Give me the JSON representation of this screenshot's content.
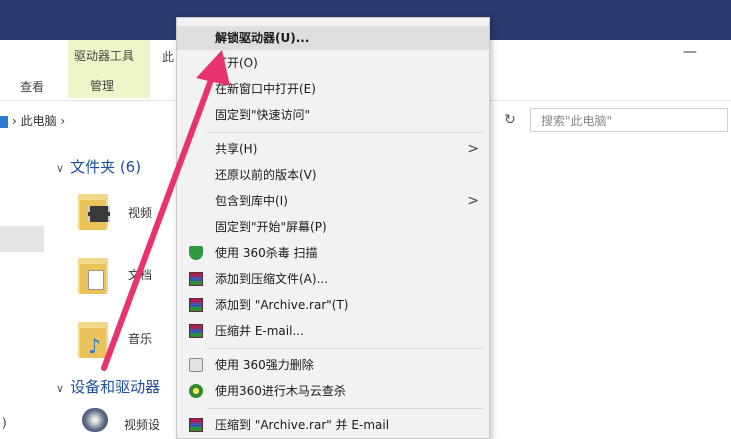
{
  "ribbon": {
    "context_tab_label": "驱动器工具",
    "context_tab_sub": "管理",
    "tab_this": "此",
    "tab_view": "查看",
    "minimize": "—"
  },
  "addressbar": {
    "path": "› 此电脑 ›",
    "search_placeholder": "搜索\"此电脑\""
  },
  "sections": {
    "folders": "文件夹 (6)",
    "devices": "设备和驱动器"
  },
  "folders": [
    {
      "label": "视频"
    },
    {
      "label": "文档"
    },
    {
      "label": "音乐"
    }
  ],
  "drive": {
    "label": "视频设"
  },
  "left_edge": ")",
  "menu": {
    "items": [
      {
        "label": "解锁驱动器(U)...",
        "icon": "none"
      },
      {
        "label": "打开(O)",
        "icon": "none"
      },
      {
        "label": "在新窗口中打开(E)",
        "icon": "none"
      },
      {
        "label": "固定到\"快速访问\"",
        "icon": "none"
      },
      {
        "label": "共享(H)",
        "icon": "none",
        "submenu": ">"
      },
      {
        "label": "还原以前的版本(V)",
        "icon": "none"
      },
      {
        "label": "包含到库中(I)",
        "icon": "none",
        "submenu": ">"
      },
      {
        "label": "固定到\"开始\"屏幕(P)",
        "icon": "none"
      },
      {
        "label": "使用 360杀毒 扫描",
        "icon": "shield-icon"
      },
      {
        "label": "添加到压缩文件(A)...",
        "icon": "winrar-icon"
      },
      {
        "label": "添加到 \"Archive.rar\"(T)",
        "icon": "winrar-icon"
      },
      {
        "label": "压缩并 E-mail...",
        "icon": "winrar-icon"
      },
      {
        "label": "使用 360强力删除",
        "icon": "shredder-icon"
      },
      {
        "label": "使用360进行木马云查杀",
        "icon": "trojan-scan-icon"
      },
      {
        "label": "压缩到 \"Archive.rar\" 并 E-mail",
        "icon": "winrar-icon"
      }
    ]
  },
  "colors": {
    "titlebar": "#2b3a6e",
    "context_tab": "#eef6c9",
    "menu_bg": "#f2f2f2",
    "menu_highlight": "#dedede",
    "annotation_arrow": "#e8336f",
    "section_heading": "#1f4e9e"
  }
}
